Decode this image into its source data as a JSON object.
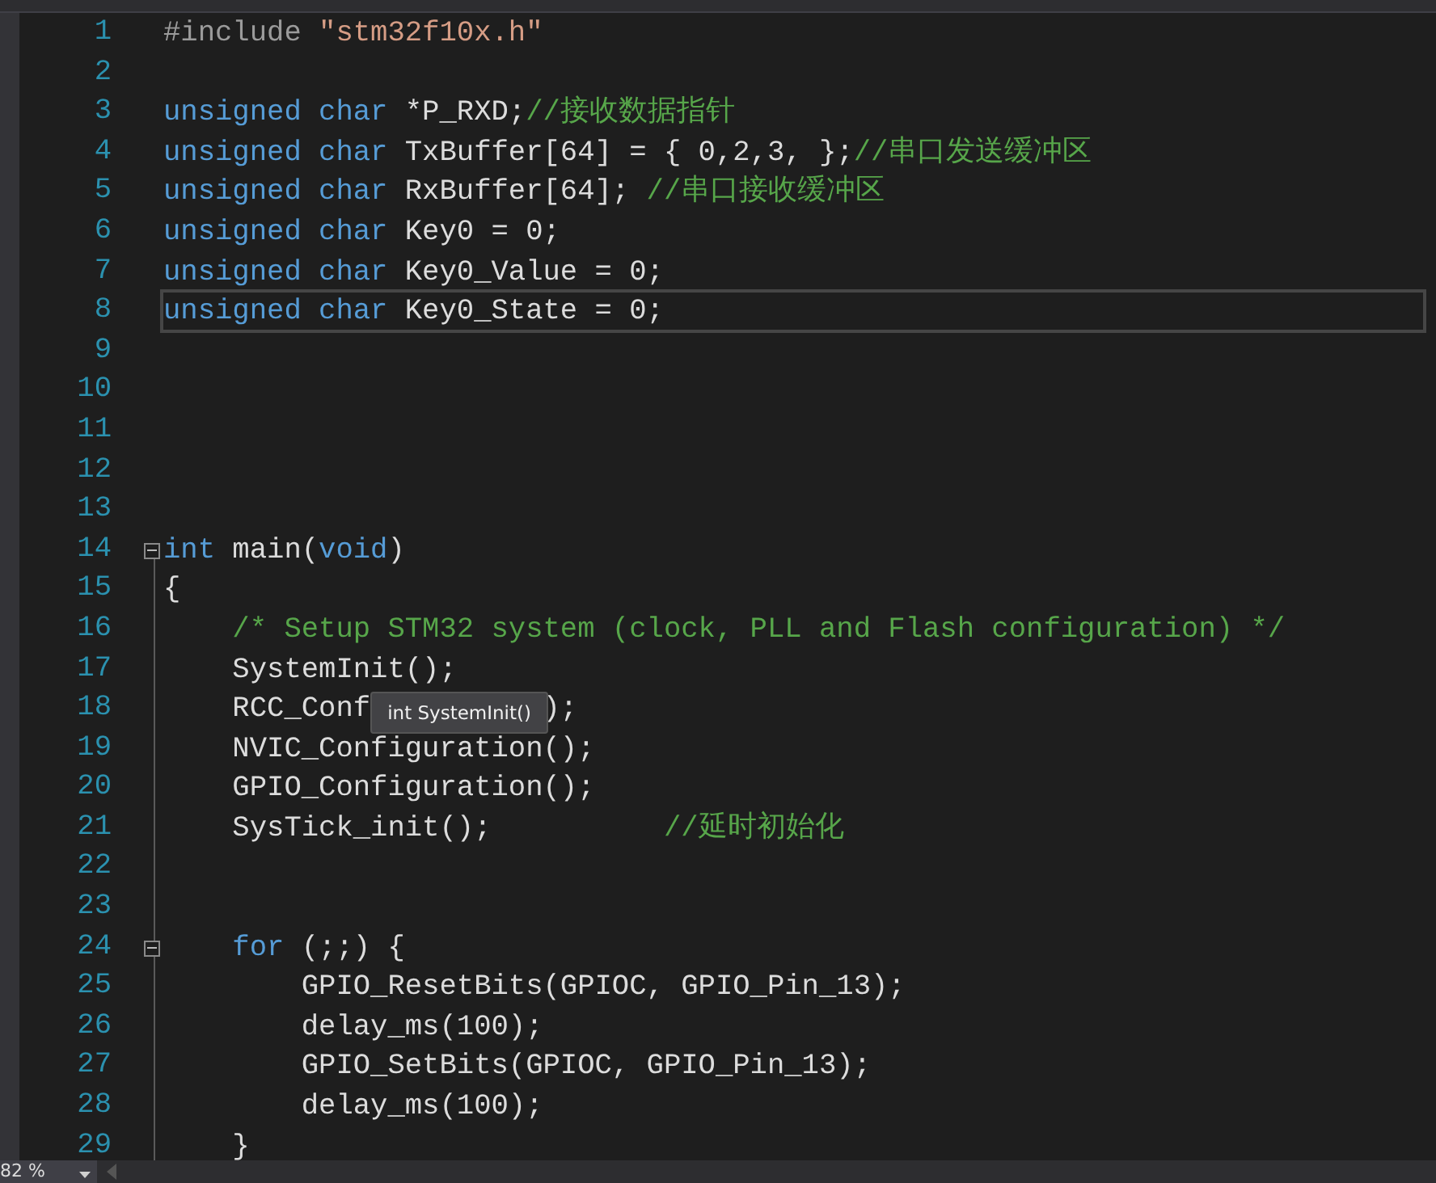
{
  "editor": {
    "lines": [
      {
        "number": "1",
        "current": false,
        "fold_marker": false,
        "tokens": [
          {
            "kind": "pre",
            "text": "#include "
          },
          {
            "kind": "str",
            "text": "\"stm32f10x.h\""
          }
        ]
      },
      {
        "number": "2",
        "current": false,
        "fold_marker": false
      },
      {
        "number": "3",
        "current": false,
        "fold_marker": false,
        "tokens": [
          {
            "kind": "kw",
            "text": "unsigned char"
          },
          {
            "kind": "plain",
            "text": " *P_RXD;"
          },
          {
            "kind": "comment",
            "text": "//接收数据指针"
          }
        ]
      },
      {
        "number": "4",
        "current": false,
        "fold_marker": false,
        "tokens": [
          {
            "kind": "kw",
            "text": "unsigned char"
          },
          {
            "kind": "plain",
            "text": " TxBuffer[64] = { 0,2,3, };"
          },
          {
            "kind": "comment",
            "text": "//串口发送缓冲区"
          }
        ]
      },
      {
        "number": "5",
        "current": false,
        "fold_marker": false,
        "tokens": [
          {
            "kind": "kw",
            "text": "unsigned char"
          },
          {
            "kind": "plain",
            "text": " RxBuffer[64]; "
          },
          {
            "kind": "comment",
            "text": "//串口接收缓冲区"
          }
        ]
      },
      {
        "number": "6",
        "current": false,
        "fold_marker": false,
        "tokens": [
          {
            "kind": "kw",
            "text": "unsigned char"
          },
          {
            "kind": "plain",
            "text": " Key0 = 0;"
          }
        ]
      },
      {
        "number": "7",
        "current": false,
        "fold_marker": false,
        "tokens": [
          {
            "kind": "kw",
            "text": "unsigned char"
          },
          {
            "kind": "plain",
            "text": " Key0_Value = 0;"
          }
        ]
      },
      {
        "number": "8",
        "current": true,
        "fold_marker": false,
        "tokens": [
          {
            "kind": "kw",
            "text": "unsigned char"
          },
          {
            "kind": "plain",
            "text": " Key0_State = 0;"
          }
        ]
      },
      {
        "number": "9",
        "current": false,
        "fold_marker": false
      },
      {
        "number": "10",
        "current": false,
        "fold_marker": false
      },
      {
        "number": "11",
        "current": false,
        "fold_marker": false
      },
      {
        "number": "12",
        "current": false,
        "fold_marker": false
      },
      {
        "number": "13",
        "current": false,
        "fold_marker": false
      },
      {
        "number": "14",
        "current": false,
        "fold_marker": true,
        "tokens": [
          {
            "kind": "kw",
            "text": "int"
          },
          {
            "kind": "plain",
            "text": " main("
          },
          {
            "kind": "kw",
            "text": "void"
          },
          {
            "kind": "plain",
            "text": ")"
          }
        ]
      },
      {
        "number": "15",
        "current": false,
        "fold_marker": false,
        "tokens": [
          {
            "kind": "plain",
            "text": "{"
          }
        ]
      },
      {
        "number": "16",
        "current": false,
        "fold_marker": false,
        "tokens": [
          {
            "kind": "comment",
            "text": "    /* Setup STM32 system (clock, PLL and Flash configuration) */"
          }
        ]
      },
      {
        "number": "17",
        "current": false,
        "fold_marker": false,
        "tokens": [
          {
            "kind": "plain",
            "text": "    SystemInit();"
          }
        ]
      },
      {
        "number": "18",
        "current": false,
        "fold_marker": false,
        "tokens": [
          {
            "kind": "plain",
            "text": "    RCC_Conf"
          },
          {
            "kind": "tooltip",
            "text": "int SystemInit()"
          },
          {
            "kind": "plain",
            "text": ");"
          }
        ]
      },
      {
        "number": "19",
        "current": false,
        "fold_marker": false,
        "tokens": [
          {
            "kind": "plain",
            "text": "    NVIC_Configuration();"
          }
        ]
      },
      {
        "number": "20",
        "current": false,
        "fold_marker": false,
        "tokens": [
          {
            "kind": "plain",
            "text": "    GPIO_Configuration();"
          }
        ]
      },
      {
        "number": "21",
        "current": false,
        "fold_marker": false,
        "tokens": [
          {
            "kind": "plain",
            "text": "    SysTick_init();          "
          },
          {
            "kind": "comment",
            "text": "//延时初始化"
          }
        ]
      },
      {
        "number": "22",
        "current": false,
        "fold_marker": false
      },
      {
        "number": "23",
        "current": false,
        "fold_marker": false
      },
      {
        "number": "24",
        "current": false,
        "fold_marker": true,
        "tokens": [
          {
            "kind": "kw",
            "text": "    for"
          },
          {
            "kind": "plain",
            "text": " (;;) {"
          }
        ]
      },
      {
        "number": "25",
        "current": false,
        "fold_marker": false,
        "tokens": [
          {
            "kind": "plain",
            "text": "        GPIO_ResetBits(GPIOC, GPIO_Pin_13);"
          }
        ]
      },
      {
        "number": "26",
        "current": false,
        "fold_marker": false,
        "tokens": [
          {
            "kind": "plain",
            "text": "        delay_ms(100);"
          }
        ]
      },
      {
        "number": "27",
        "current": false,
        "fold_marker": false,
        "tokens": [
          {
            "kind": "plain",
            "text": "        GPIO_SetBits(GPIOC, GPIO_Pin_13);"
          }
        ]
      },
      {
        "number": "28",
        "current": false,
        "fold_marker": false,
        "tokens": [
          {
            "kind": "plain",
            "text": "        delay_ms(100);"
          }
        ]
      },
      {
        "number": "29",
        "current": false,
        "fold_marker": false,
        "tokens": [
          {
            "kind": "plain",
            "text": "    }"
          }
        ]
      }
    ]
  },
  "status_bar": {
    "zoom": "82 %"
  }
}
